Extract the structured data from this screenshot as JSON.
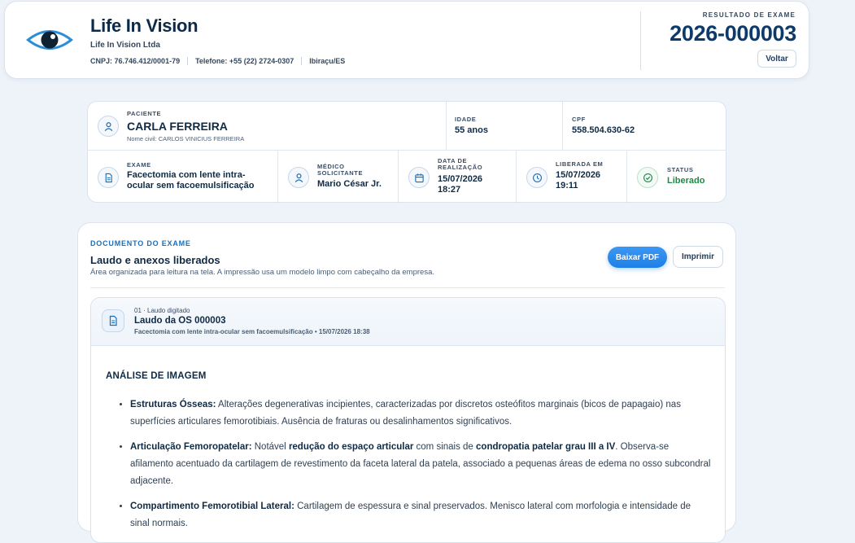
{
  "header": {
    "brand_name": "Life In Vision",
    "company": "Life In Vision Ltda",
    "cnpj": "CNPJ: 76.746.412/0001-79",
    "phone": "Telefone: +55 (22) 2724-0307",
    "city": "Ibiraçu/ES",
    "result_label": "RESULTADO DE EXAME",
    "result_number": "2026-000003",
    "back_label": "Voltar"
  },
  "patient": {
    "label": "PACIENTE",
    "name": "CARLA FERREIRA",
    "civil_name": "Nome civil: CARLOS VINICIUS FERREIRA",
    "age_label": "IDADE",
    "age": "55 anos",
    "cpf_label": "CPF",
    "cpf": "558.504.630-62"
  },
  "exam": {
    "exam_label": "EXAME",
    "exam_line1": "Facectomia com lente intra-",
    "exam_line2": "ocular sem facoemulsificação",
    "doctor_label_1": "MÉDICO",
    "doctor_label_2": "SOLICITANTE",
    "doctor": "Mario César Jr.",
    "date_label_1": "DATA DE",
    "date_label_2": "REALIZAÇÃO",
    "date_day": "15/07/2026",
    "date_time": "18:27",
    "released_label": "LIBERADA EM",
    "released_day": "15/07/2026",
    "released_time": "19:11",
    "status_label": "STATUS",
    "status": "Liberado"
  },
  "document": {
    "kicker": "DOCUMENTO DO EXAME",
    "title": "Laudo e anexos liberados",
    "description": "Área organizada para leitura na tela. A impressão usa um modelo limpo com cabeçalho da empresa.",
    "pdf_label": "Baixar PDF",
    "print_label": "Imprimir"
  },
  "laudo": {
    "kicker": "01 · Laudo digitado",
    "title": "Laudo da OS 000003",
    "meta": "Facectomia com lente intra-ocular sem facoemulsificação • 15/07/2026 18:38",
    "heading": "ANÁLISE DE IMAGEM",
    "item1_term": "Estruturas Ósseas:",
    "item1_text": " Alterações degenerativas incipientes, caracterizadas por discretos osteófitos marginais (bicos de papagaio) nas superfícies articulares femorotibiais. Ausência de fraturas ou desalinhamentos significativos.",
    "item2_term": "Articulação Femoropatelar:",
    "item2_text_a": " Notável ",
    "item2_bold_a": "redução do espaço articular",
    "item2_text_b": " com sinais de ",
    "item2_bold_b": "condropatia patelar grau III a IV",
    "item2_text_c": ". Observa-se afilamento acentuado da cartilagem de revestimento da faceta lateral da patela, associado a pequenas áreas de edema no osso subcondral adjacente.",
    "item3_term": "Compartimento Femorotibial Lateral:",
    "item3_text": " Cartilagem de espessura e sinal preservados. Menisco lateral com morfologia e intensidade de sinal normais."
  },
  "colors": {
    "accent": "#1f7fe6",
    "brand_dark": "#0b3a6b",
    "status_green": "#1e8a45"
  },
  "icons": {
    "logo": "eye-logo-icon",
    "patient": "user-icon",
    "exam": "document-icon",
    "doctor": "user-icon",
    "date": "calendar-icon",
    "released": "clock-icon",
    "status": "check-circle-icon",
    "laudo": "document-icon"
  }
}
